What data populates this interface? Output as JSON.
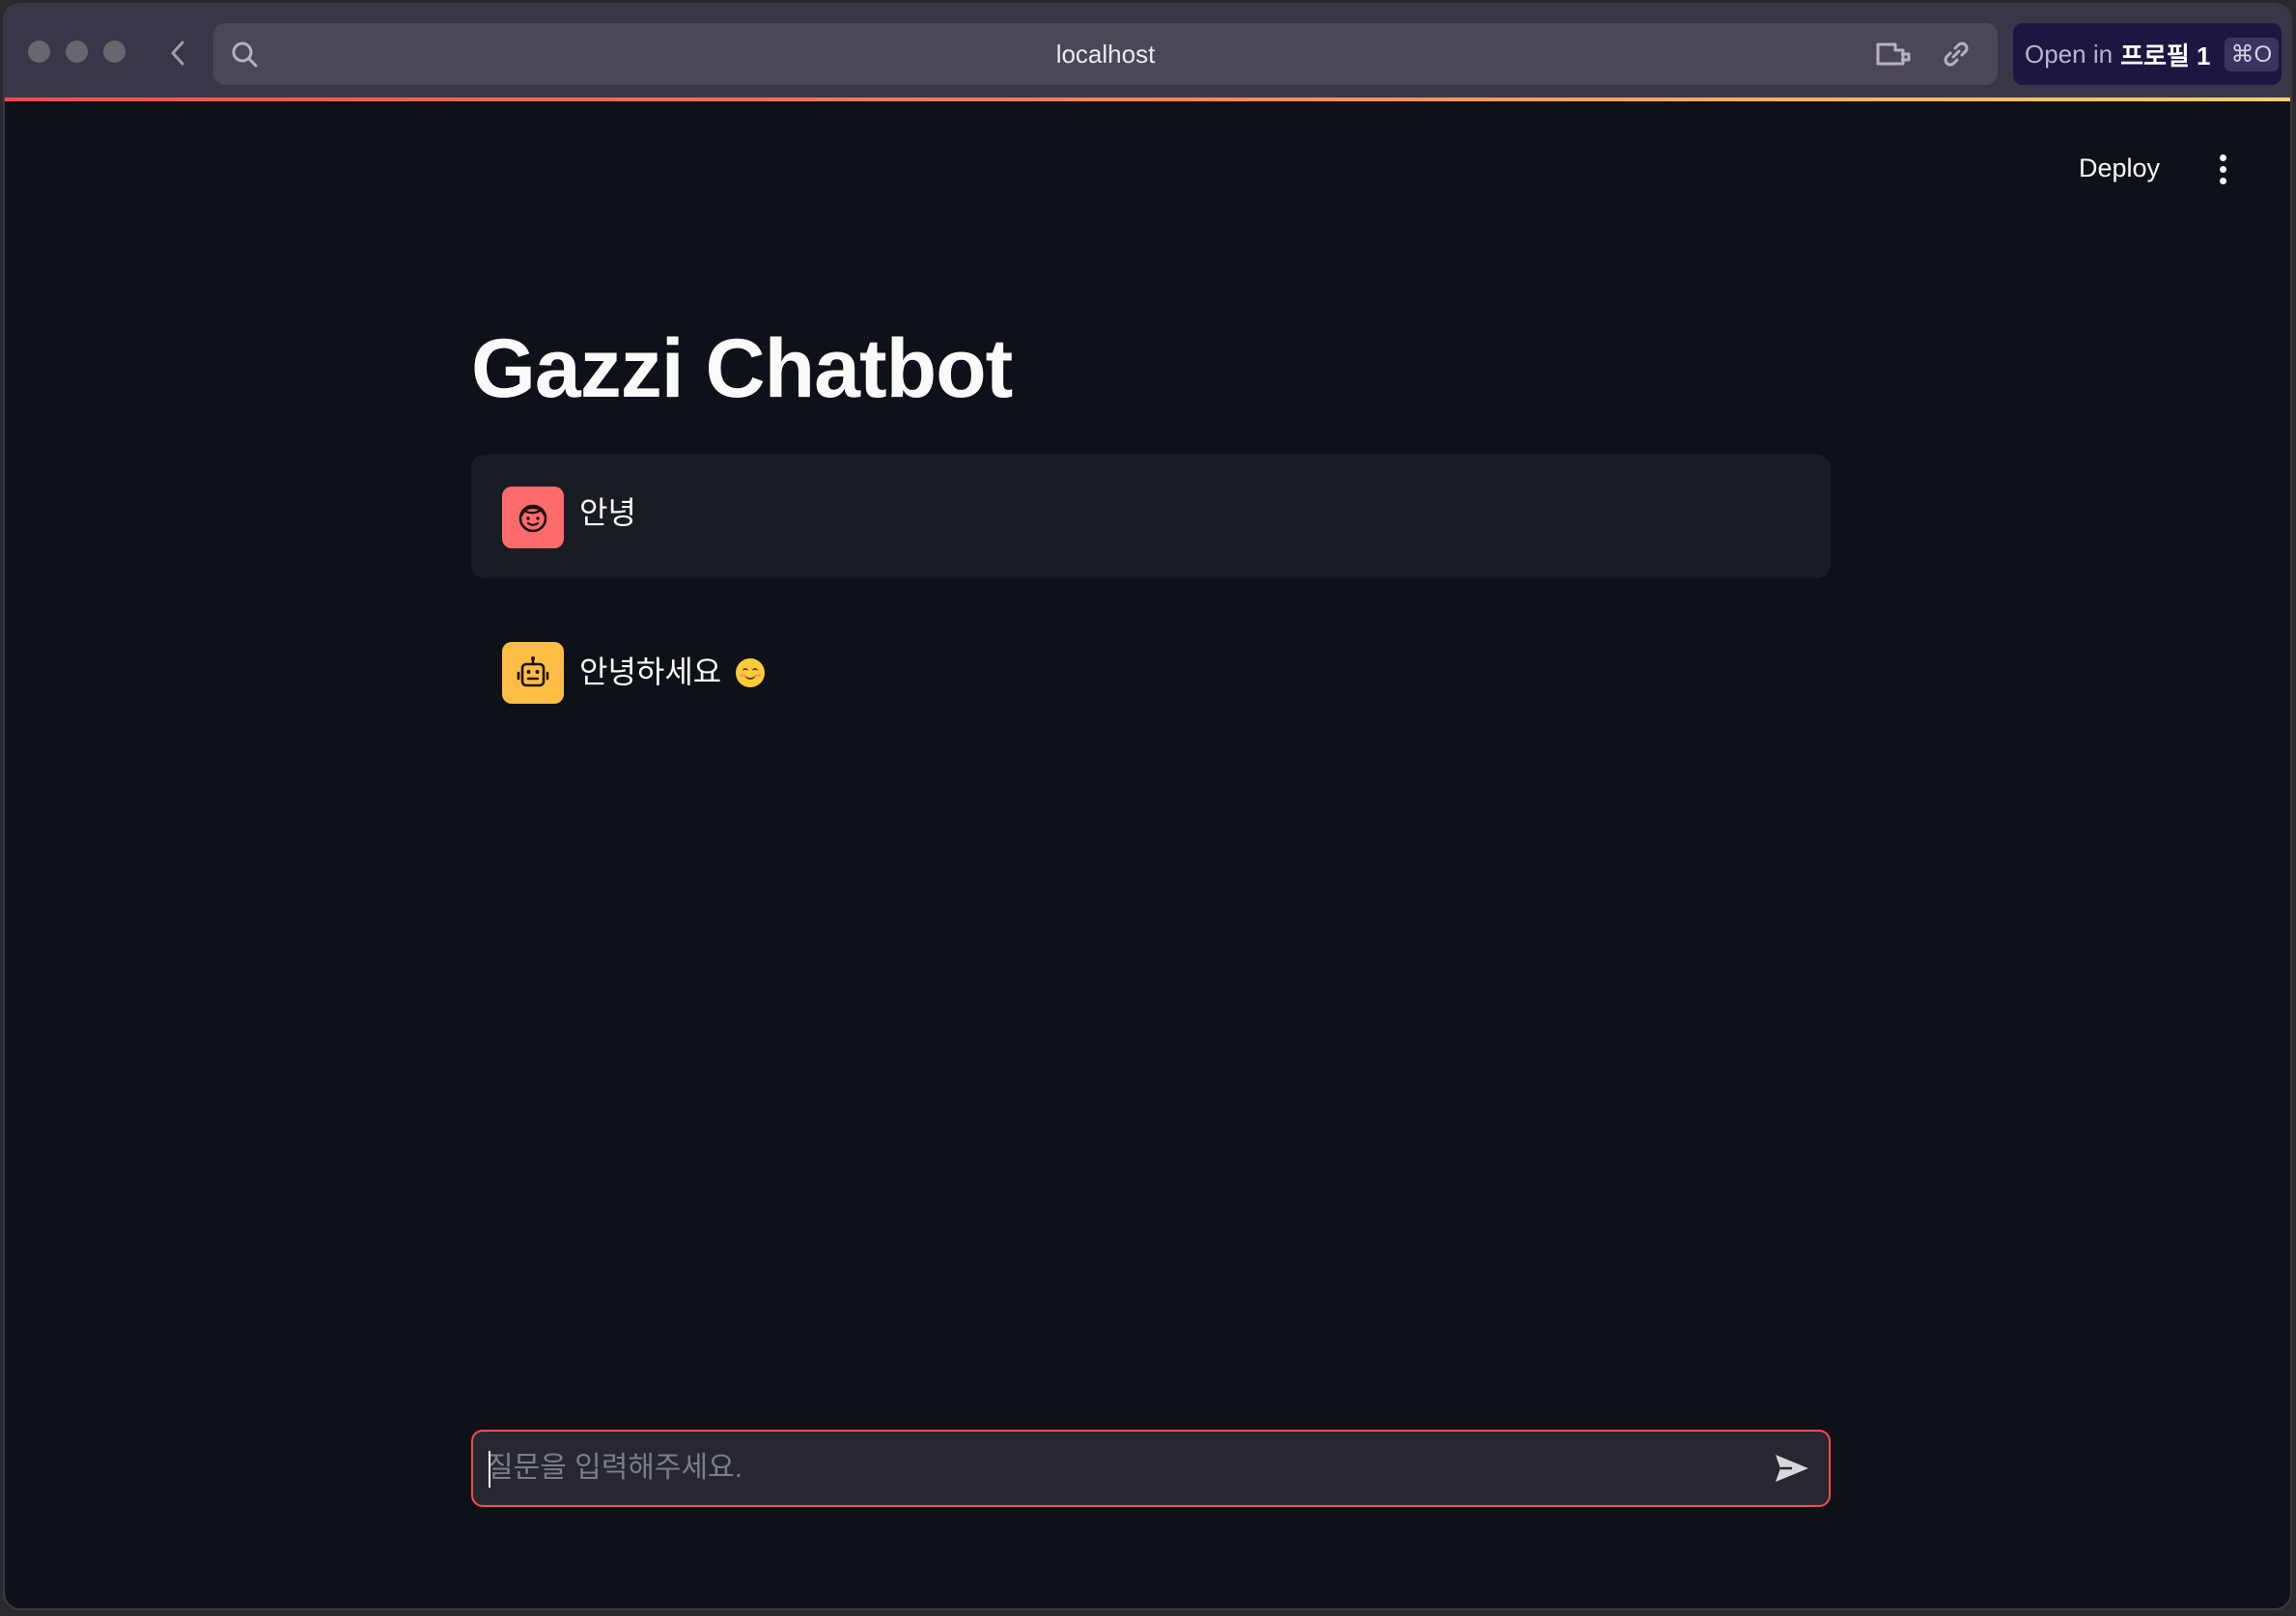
{
  "browser": {
    "url": "localhost",
    "open_in": {
      "prefix": "Open in",
      "profile": "프로필 1",
      "shortcut": "⌘O"
    }
  },
  "app": {
    "deploy_label": "Deploy",
    "title": "Gazzi Chatbot",
    "messages": [
      {
        "role": "user",
        "avatar_icon": "face-icon",
        "text": "안녕"
      },
      {
        "role": "assistant",
        "avatar_icon": "robot-icon",
        "text": "안녕하세요",
        "emoji": "smiling-face-emoji"
      }
    ],
    "chat_input": {
      "placeholder": "질문을 입력해주세요.",
      "value": ""
    }
  },
  "colors": {
    "background": "#0e1117",
    "primary": "#ff4b4b",
    "user_avatar": "#ff6b6b",
    "bot_avatar": "#ffbd45",
    "user_bubble": "#1a1c24"
  }
}
